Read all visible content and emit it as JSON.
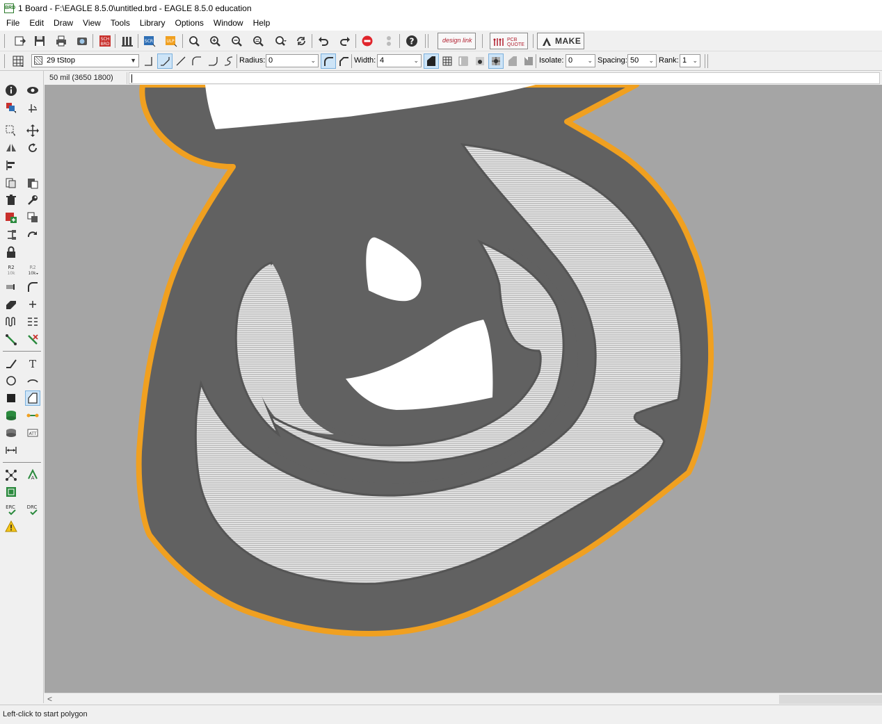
{
  "window": {
    "title": "1 Board - F:\\EAGLE 8.5.0\\untitled.brd - EAGLE 8.5.0 education",
    "icon_text": "BRD"
  },
  "menu": [
    "File",
    "Edit",
    "Draw",
    "View",
    "Tools",
    "Library",
    "Options",
    "Window",
    "Help"
  ],
  "toolbar": {
    "sch_label": "SCH",
    "brd_label": "BRD",
    "scr_label": "SCR",
    "ulp_label": "ULP",
    "designlink_label": "design link",
    "pcb_quote_label": "PCB QUOTE",
    "make_label": "MAKE"
  },
  "params": {
    "layer": "29 tStop",
    "radius_label": "Radius:",
    "radius_value": "0",
    "width_label": "Width:",
    "width_value": "4",
    "isolate_label": "Isolate:",
    "isolate_value": "0",
    "spacing_label": "Spacing:",
    "spacing_value": "50",
    "rank_label": "Rank:",
    "rank_value": "1"
  },
  "coordinates": "50 mil (3650 1800)",
  "command_line": "",
  "sidebar": {
    "r2_label": "R2",
    "value_label": "10k",
    "erc_label": "ERC",
    "drc_label": "DRC",
    "text_tool_glyph": "T"
  },
  "status": "Left-click to start polygon",
  "colors": {
    "canvas_bg": "#a5a5a5",
    "board_fill": "#616161",
    "outline": "#f0a020",
    "hatch": "#d2d2d2",
    "white_cutout": "#ffffff"
  }
}
